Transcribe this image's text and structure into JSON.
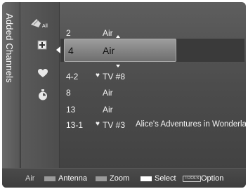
{
  "side_title": "Added Channels",
  "modes": [
    {
      "icon": "all-channels-icon",
      "label": "All"
    },
    {
      "icon": "added-channels-icon"
    },
    {
      "icon": "favorite-heart-icon"
    },
    {
      "icon": "timer-clock-icon"
    }
  ],
  "channels": [
    {
      "number": "2",
      "name": "Air"
    },
    {
      "number": "4",
      "name": "Air",
      "selected": true
    },
    {
      "number": "4-2",
      "icon": "♥",
      "name": "TV #8"
    },
    {
      "number": "8",
      "name": "Air"
    },
    {
      "number": "13",
      "name": "Air"
    },
    {
      "number": "13-1",
      "icon": "♥",
      "name": "TV #3",
      "program": "Alice's Adventures in Wonderland"
    }
  ],
  "footer": {
    "source": "Air",
    "antenna": "Antenna",
    "zoom": "Zoom",
    "select": "Select",
    "tools_key": "TOOLS",
    "option": "Option"
  },
  "colors": {
    "panel": "#4c4c4c",
    "highlight": "#8f8f8f",
    "text": "#f2f2f2"
  }
}
